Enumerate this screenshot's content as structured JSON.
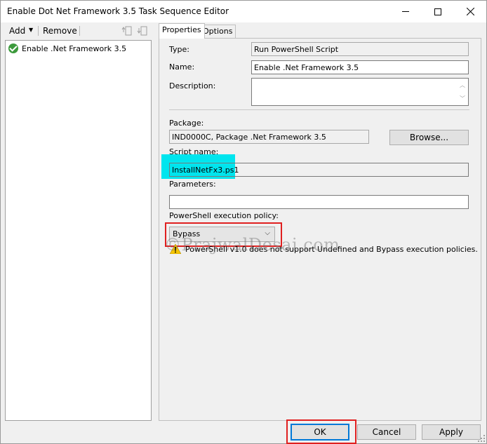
{
  "window": {
    "title": "Enable Dot Net Framework 3.5 Task Sequence Editor",
    "minimize_icon": "minimize-icon",
    "maximize_icon": "maximize-icon",
    "close_icon": "close-icon"
  },
  "toolbar": {
    "add_label": "Add",
    "remove_label": "Remove"
  },
  "tree": {
    "items": [
      {
        "label": "Enable .Net Framework 3.5",
        "icon": "green-check-icon"
      }
    ]
  },
  "tabs": [
    {
      "label": "Properties",
      "selected": true
    },
    {
      "label": "Options",
      "selected": false
    }
  ],
  "properties": {
    "type_label": "Type:",
    "type_value": "Run PowerShell Script",
    "name_label": "Name:",
    "name_value": "Enable .Net Framework 3.5",
    "description_label": "Description:",
    "description_value": "",
    "package_label": "Package:",
    "package_value": "IND0000C, Package .Net Framework 3.5",
    "browse_label": "Browse...",
    "script_name_label": "Script name:",
    "script_name_value": "InstallNetFx3.ps1",
    "parameters_label": "Parameters:",
    "parameters_value": "",
    "policy_label": "PowerShell execution policy:",
    "policy_value": "Bypass",
    "warning_text": "PowerShell v1.0 does not support Undefined and Bypass execution policies."
  },
  "watermark": "©PrajwalDesai.com",
  "buttons": {
    "ok": "OK",
    "cancel": "Cancel",
    "apply": "Apply"
  },
  "colors": {
    "highlight": "#00e5ee",
    "annotation_red": "#e02020",
    "focus_blue": "#0078d7"
  }
}
